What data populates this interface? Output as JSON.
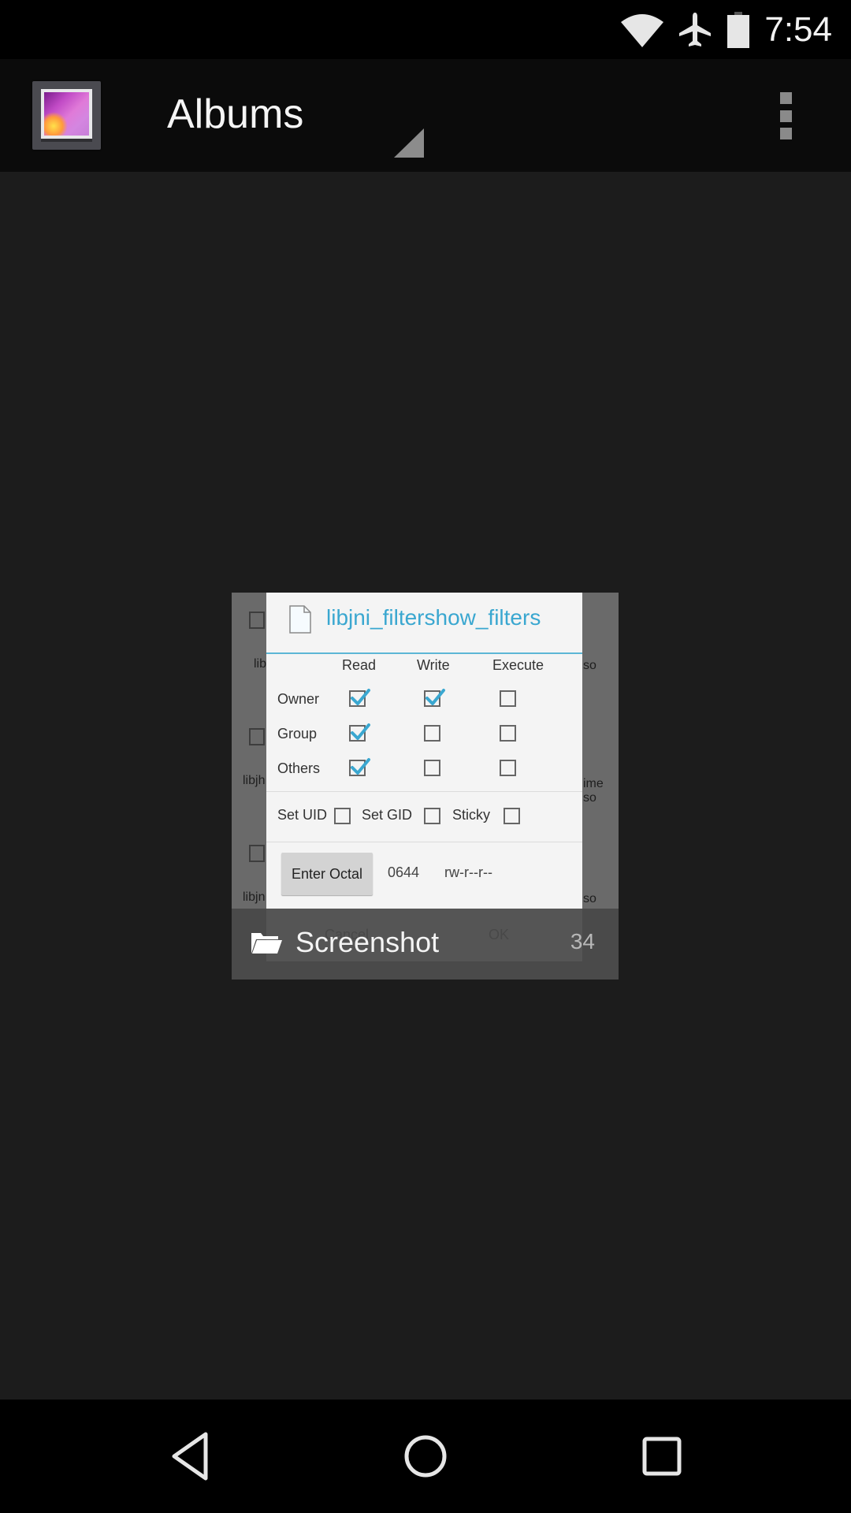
{
  "status_bar": {
    "time": "7:54",
    "icons": [
      "wifi-icon",
      "airplane-mode-icon",
      "battery-icon"
    ]
  },
  "action_bar": {
    "app_icon": "gallery-app-icon",
    "title": "Albums",
    "spinner_indicator": "dropdown-triangle-icon",
    "overflow_icon": "overflow-menu-icon"
  },
  "album": {
    "name": "Screenshot",
    "count": "34",
    "icon": "folder-icon",
    "thumbnail": {
      "background_fragments": {
        "left": [
          "lib",
          "libjh",
          "libjn"
        ],
        "right": [
          "so",
          "ime",
          "so",
          "so"
        ]
      },
      "dialog": {
        "title": "libjni_filtershow_filters",
        "title_icon": "file-icon",
        "accent_color": "#3aa7d0",
        "columns": [
          "Read",
          "Write",
          "Execute"
        ],
        "rows": [
          {
            "label": "Owner",
            "read": true,
            "write": true,
            "execute": false
          },
          {
            "label": "Group",
            "read": true,
            "write": false,
            "execute": false
          },
          {
            "label": "Others",
            "read": true,
            "write": false,
            "execute": false
          }
        ],
        "special": [
          {
            "label": "Set UID",
            "checked": false
          },
          {
            "label": "Set GID",
            "checked": false
          },
          {
            "label": "Sticky",
            "checked": false
          }
        ],
        "enter_octal_label": "Enter Octal",
        "octal_value": "0644",
        "permission_string": "rw-r--r--",
        "cancel_label": "Cancel",
        "ok_label": "OK"
      }
    }
  },
  "nav_bar": {
    "back": "back-icon",
    "home": "home-icon",
    "recents": "recents-icon"
  }
}
